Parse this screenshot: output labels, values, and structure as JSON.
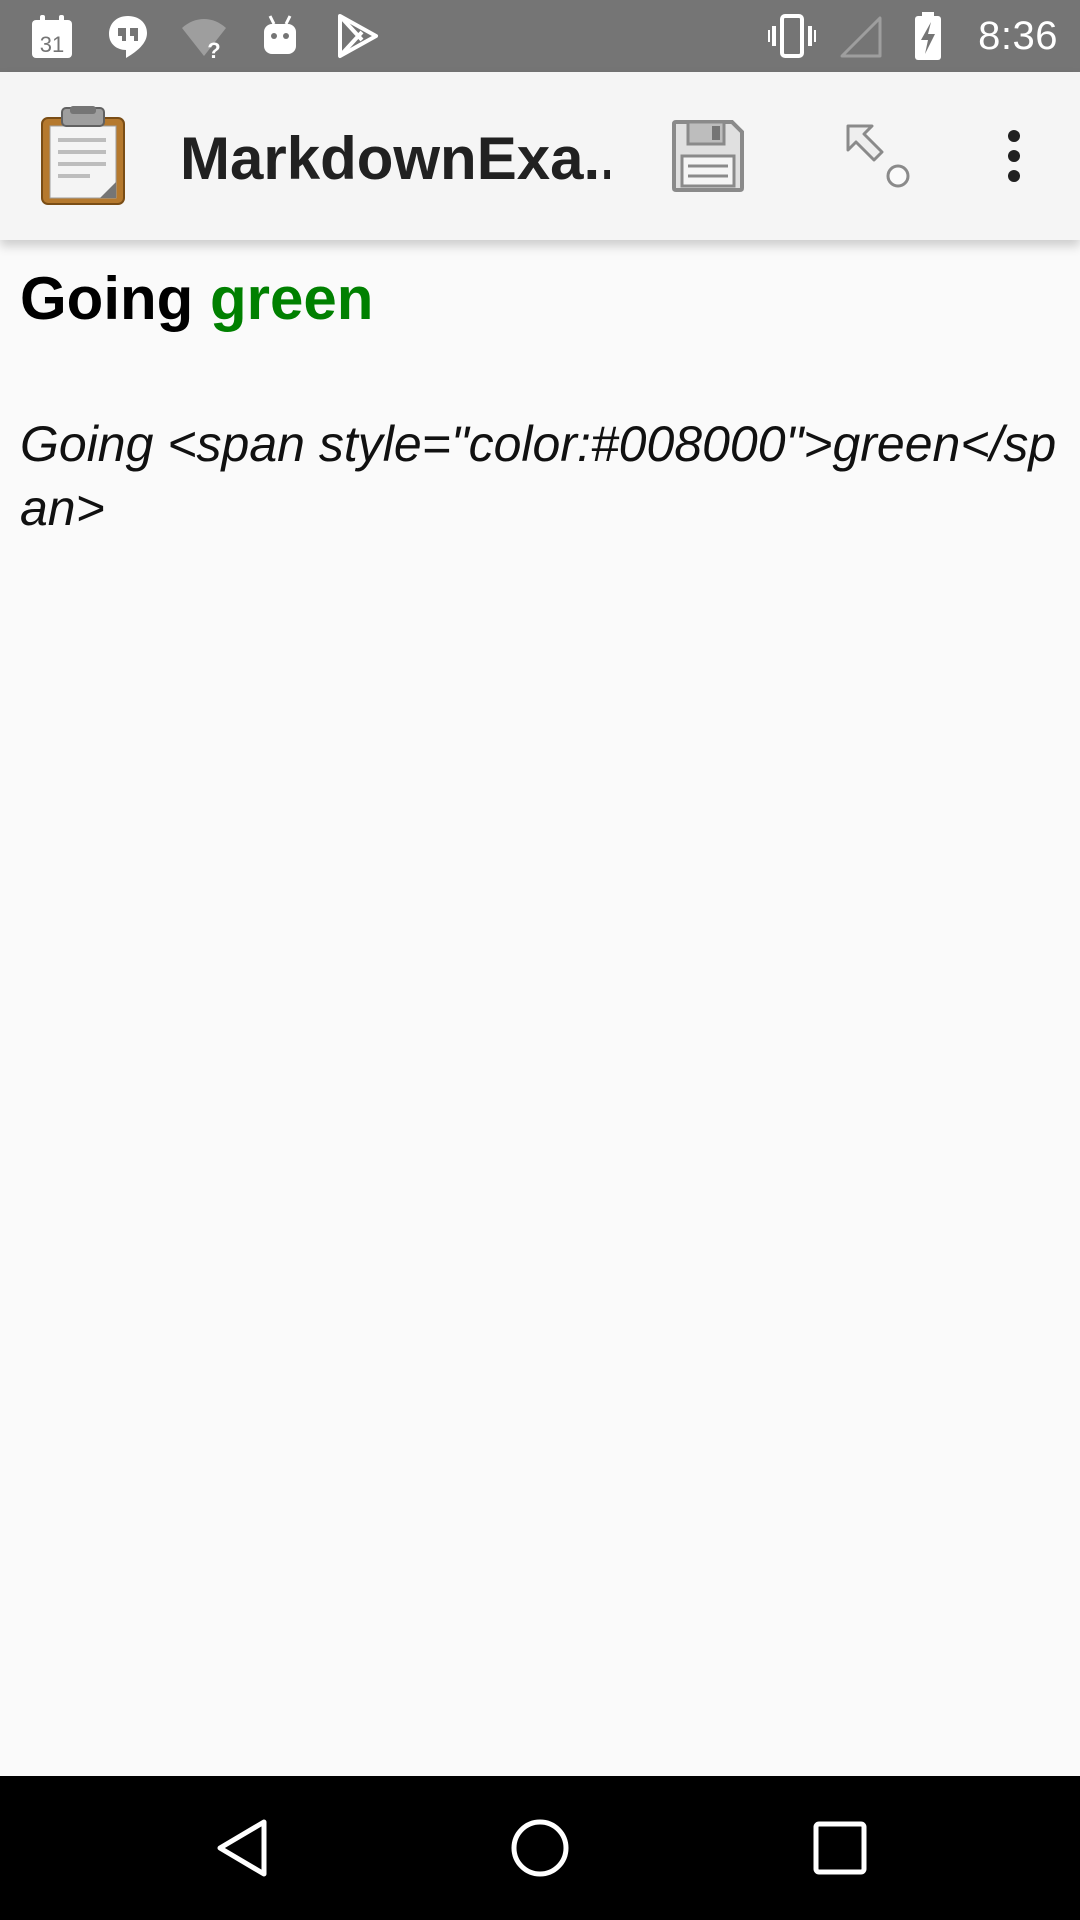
{
  "status_bar": {
    "calendar_date": "31",
    "time": "8:36",
    "icons_left": [
      "calendar-icon",
      "hangouts-icon",
      "wifi-unknown-icon",
      "android-icon",
      "play-store-icon"
    ],
    "icons_right": [
      "vibrate-icon",
      "no-signal-icon",
      "battery-charging-icon"
    ]
  },
  "toolbar": {
    "title": "MarkdownExa...",
    "actions": [
      "save-icon",
      "edit-pointer-icon",
      "more-options-icon"
    ]
  },
  "content": {
    "heading_prefix": "Going ",
    "heading_green": "green",
    "raw_line": "Going <span style=\"color:#008000\">green</span>"
  },
  "colors": {
    "status_bar_bg": "#757575",
    "toolbar_bg": "#f5f5f5",
    "page_bg": "#fafafa",
    "accent_green": "#008000",
    "nav_bar_bg": "#000000"
  },
  "navigation": [
    "back-icon",
    "home-icon",
    "recents-icon"
  ]
}
